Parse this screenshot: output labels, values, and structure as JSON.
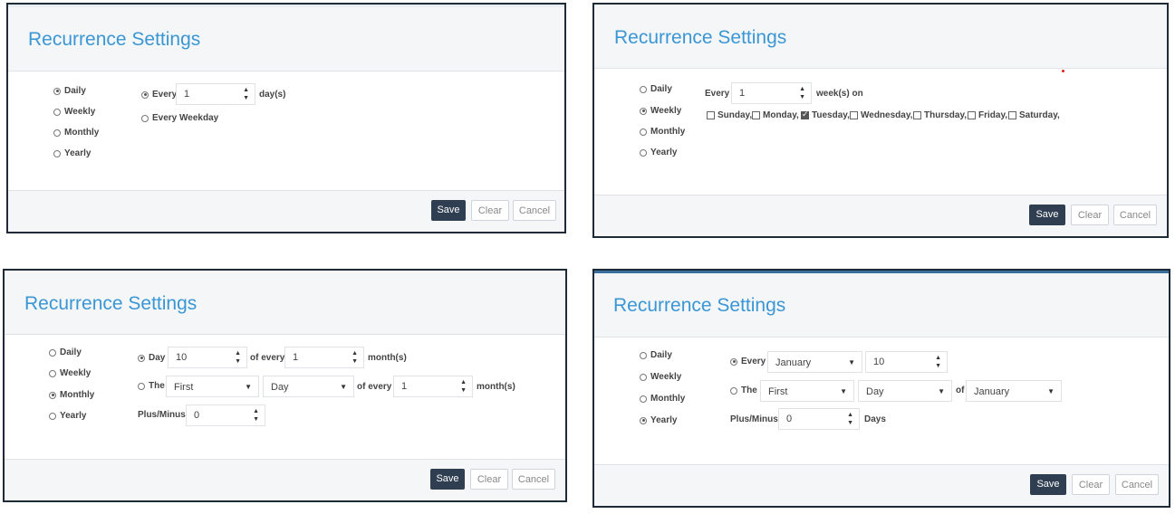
{
  "dialog_title": "Recurrence Settings",
  "recurrence_types": [
    "Daily",
    "Weekly",
    "Monthly",
    "Yearly"
  ],
  "buttons": {
    "save": "Save",
    "clear": "Clear",
    "cancel": "Cancel"
  },
  "daily": {
    "selected": "Daily",
    "every_label": "Every",
    "every_value": "1",
    "unit": "day(s)",
    "weekday_label": "Every Weekday"
  },
  "weekly": {
    "selected": "Weekly",
    "every_label": "Every",
    "every_value": "1",
    "unit": "week(s) on",
    "days": [
      {
        "label": "Sunday,",
        "checked": false
      },
      {
        "label": "Monday,",
        "checked": false
      },
      {
        "label": "Tuesday,",
        "checked": true
      },
      {
        "label": "Wednesday,",
        "checked": false
      },
      {
        "label": "Thursday,",
        "checked": false
      },
      {
        "label": "Friday,",
        "checked": false
      },
      {
        "label": "Saturday,",
        "checked": false
      }
    ]
  },
  "monthly": {
    "selected": "Monthly",
    "day_label": "Day",
    "day_value": "10",
    "of_every_label": "of every",
    "of_every_value": "1",
    "months_unit": "month(s)",
    "the_label": "The",
    "the_ordinal": "First",
    "the_day": "Day",
    "of_every_label2": "of every",
    "of_every_value2": "1",
    "months_unit2": "month(s)",
    "plusminus_label": "Plus/Minus",
    "plusminus_value": "0"
  },
  "yearly": {
    "selected": "Yearly",
    "every_label": "Every",
    "every_month": "January",
    "every_day": "10",
    "the_label": "The",
    "the_ordinal": "First",
    "the_day": "Day",
    "of_label": "of",
    "of_month": "January",
    "plusminus_label": "Plus/Minus",
    "plusminus_value": "0",
    "days_unit": "Days"
  },
  "colors": {
    "title": "#3a97d4",
    "save_bg": "#2f3e51",
    "border": "#1e2a38"
  }
}
